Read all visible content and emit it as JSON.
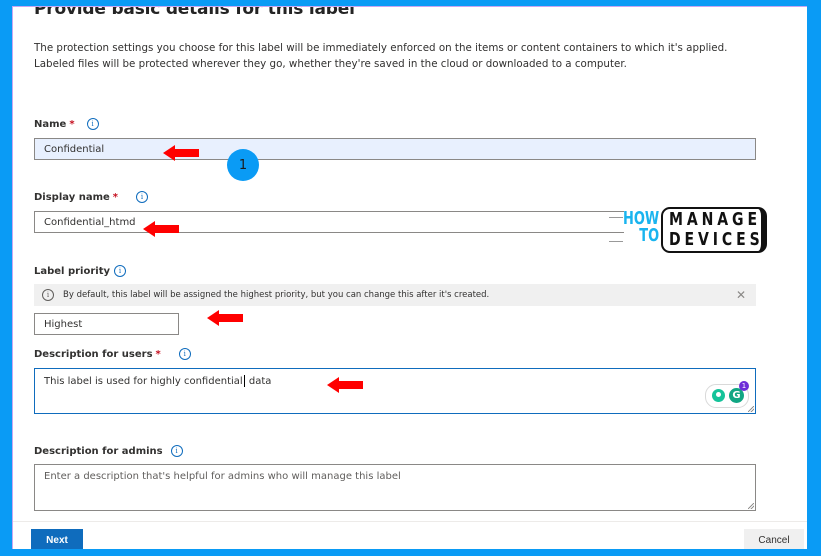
{
  "page": {
    "title": "Provide basic details for this label",
    "intro_line1": "The protection settings you choose for this label will be immediately enforced on the items or content containers to which it's applied.",
    "intro_line2": "Labeled files will be protected wherever they go, whether they're saved in the cloud or downloaded to a computer."
  },
  "fields": {
    "name": {
      "label": "Name",
      "required_mark": "*",
      "value": "Confidential"
    },
    "display_name": {
      "label": "Display name",
      "required_mark": "*",
      "value": "Confidential_htmd"
    },
    "label_priority": {
      "label": "Label priority",
      "banner_text": "By default, this label will be assigned the highest priority, but you can change this after it's created.",
      "banner_close": "✕",
      "value": "Highest"
    },
    "description_users": {
      "label": "Description for users",
      "required_mark": "*",
      "value_before_caret": "This label is used for highly confidential",
      "value_after_caret": " data"
    },
    "description_admins": {
      "label": "Description for admins",
      "placeholder": "Enter a description that's helpful for admins who will manage this label"
    }
  },
  "icons": {
    "info": "i",
    "grammarly_g": "G",
    "grammarly_count": "1"
  },
  "annotation": {
    "step_number": "1",
    "arrow_color": "#ff0000",
    "badge_color": "#0a9bf5"
  },
  "logo": {
    "how": "HOW",
    "to": "TO",
    "manage": "MANAGE",
    "devices": "DEVICES"
  },
  "footer": {
    "next_label": "Next",
    "cancel_label": "Cancel"
  },
  "colors": {
    "frame": "#0a9bf5",
    "primary_button": "#0f6cbd",
    "focused_border": "#0f6cbd",
    "required": "#c50f1f"
  }
}
